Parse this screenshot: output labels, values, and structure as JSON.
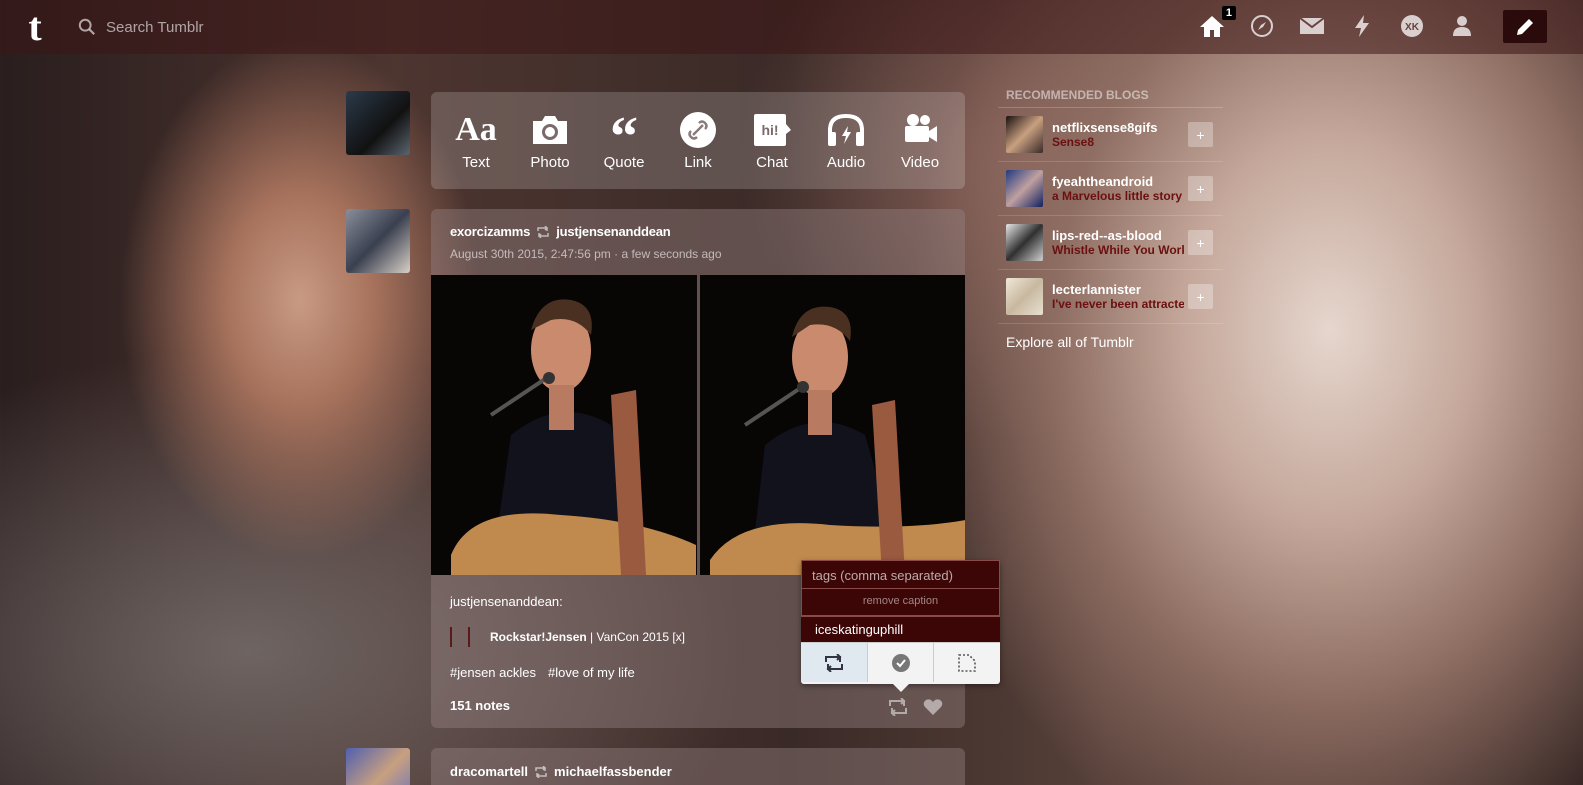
{
  "header": {
    "logo": "t",
    "search_placeholder": "Search Tumblr",
    "inbox_badge": "1"
  },
  "post_types": [
    {
      "label": "Text",
      "icon": "Aa"
    },
    {
      "label": "Photo",
      "icon": "camera"
    },
    {
      "label": "Quote",
      "icon": "quote"
    },
    {
      "label": "Link",
      "icon": "link"
    },
    {
      "label": "Chat",
      "icon": "hi!"
    },
    {
      "label": "Audio",
      "icon": "headphones"
    },
    {
      "label": "Video",
      "icon": "video-camera"
    }
  ],
  "post": {
    "author": "exorcizamms",
    "reblogged_from": "justjensenanddean",
    "date": "August 30th 2015, 2:47:56 pm · a few seconds ago",
    "body_source": "justjensenanddean:",
    "quote_bold": "Rockstar!Jensen",
    "quote_rest": " | VanCon 2015 [x]",
    "tags": [
      "#jensen ackles",
      "#love of my life"
    ],
    "notes": "151 notes"
  },
  "reblog_popup": {
    "tags_placeholder": "tags (comma separated)",
    "remove_caption": "remove caption",
    "blog": "iceskatinguphill"
  },
  "sidebar": {
    "title": "RECOMMENDED BLOGS",
    "blogs": [
      {
        "name": "netflixsense8gifs",
        "sub": "Sense8"
      },
      {
        "name": "fyeahtheandroid",
        "sub": "a Marvelous little story"
      },
      {
        "name": "lips-red--as-blood",
        "sub": "Whistle While You Work"
      },
      {
        "name": "lecterlannister",
        "sub": "I've never been attracted"
      }
    ],
    "follow_label": "+",
    "explore": "Explore all of Tumblr"
  },
  "post2": {
    "author": "dracomartell",
    "reblogged_from": "michaelfassbender"
  }
}
